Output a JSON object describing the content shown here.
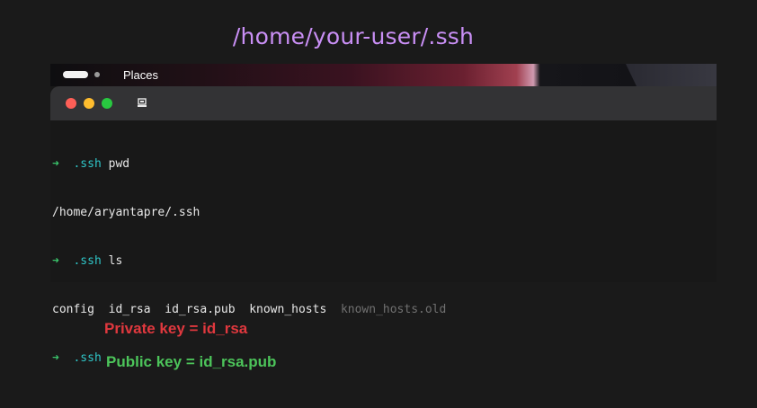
{
  "heading": "/home/your-user/.ssh",
  "topbar": {
    "label": "Places"
  },
  "terminal": {
    "lines": [
      {
        "prompt": "➜",
        "dir": ".ssh",
        "cmd": "pwd"
      },
      {
        "output": "/home/aryantapre/.ssh"
      },
      {
        "prompt": "➜",
        "dir": ".ssh",
        "cmd": "ls"
      },
      {
        "files": [
          "config",
          "id_rsa",
          "id_rsa.pub",
          "known_hosts"
        ],
        "dim_file": "known_hosts.old"
      },
      {
        "prompt": "➜",
        "dir": ".ssh",
        "cmd": ""
      }
    ]
  },
  "notes": {
    "private": "Private key = id_rsa",
    "public": "Public key = id_rsa.pub"
  },
  "colors": {
    "heading": "#c98ff5",
    "prompt_arrow": "#3ac46b",
    "prompt_dir": "#2fc6c8",
    "private_note": "#e0383e",
    "public_note": "#4cc45a"
  }
}
